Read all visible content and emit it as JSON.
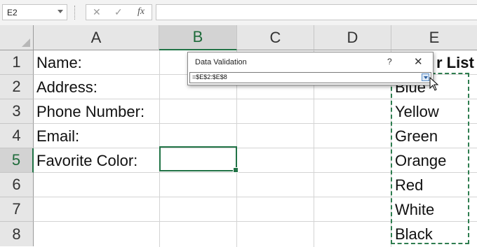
{
  "formula_bar": {
    "name_box": "E2",
    "cancel_icon": "✕",
    "enter_icon": "✓",
    "fx_label": "fx",
    "formula": ""
  },
  "columns": [
    "A",
    "B",
    "C",
    "D",
    "E"
  ],
  "rows": [
    "1",
    "2",
    "3",
    "4",
    "5",
    "6",
    "7",
    "8"
  ],
  "cells": {
    "A1": "Name:",
    "A2": "Address:",
    "A3": "Phone Number:",
    "A4": "Email:",
    "A5": "Favorite Color:",
    "E1": "r List",
    "E2": "Blue",
    "E3": "Yellow",
    "E4": "Green",
    "E5": "Orange",
    "E6": "Red",
    "E7": "White",
    "E8": "Black"
  },
  "selected_column": "B",
  "selected_row": "5",
  "dialog": {
    "title": "Data Validation",
    "help": "?",
    "close": "✕",
    "reference": "=$E$2:$E$8"
  },
  "colors": {
    "accent": "#217346",
    "marquee": "#2e7d4f"
  }
}
